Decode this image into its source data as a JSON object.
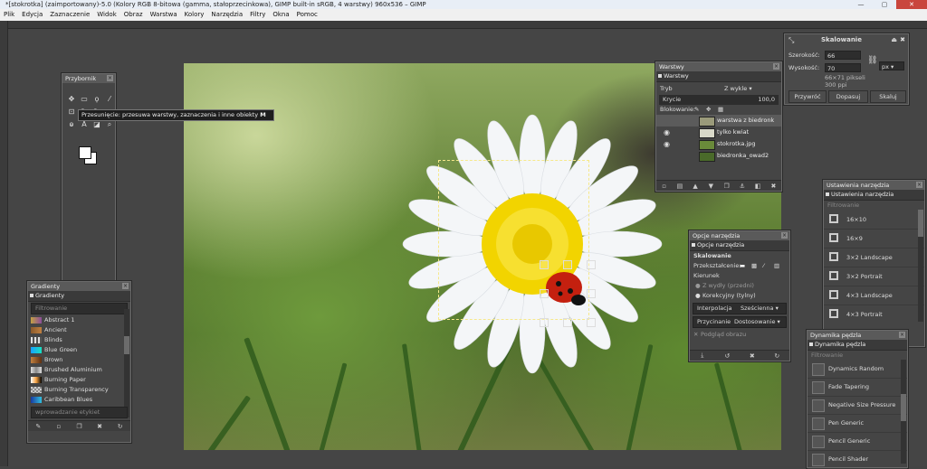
{
  "window": {
    "title": "*[stokrotka] (zaimportowany)-5.0 (Kolory RGB 8-bitowa (gamma, stałoprzecinkowa), GIMP built-in sRGB, 4 warstwy) 960x536 – GIMP",
    "minimize": "—",
    "maximize": "▢",
    "close": "✕"
  },
  "menubar": [
    "Plik",
    "Edycja",
    "Zaznaczenie",
    "Widok",
    "Obraz",
    "Warstwa",
    "Kolory",
    "Narzędzia",
    "Filtry",
    "Okna",
    "Pomoc"
  ],
  "toolbox": {
    "title": "Przybornik",
    "tooltip": "Przesunięcie: przesuwa warstwy, zaznaczenia i inne obiekty",
    "tooltip_key": "M",
    "icons": [
      "move-tool-icon",
      "rect-select-icon",
      "free-select-icon",
      "fuzzy-select-icon",
      "crop-icon",
      "rotate-icon",
      "scale-icon",
      "flip-icon",
      "paths-icon",
      "text-icon",
      "fill-icon",
      "zoom-icon"
    ],
    "glyphs": [
      "✥",
      "▭",
      "ϙ",
      "⁄",
      "⊡",
      "↻",
      "⤡",
      "⇋",
      "ⱺ",
      "A",
      "◪",
      "⌕"
    ]
  },
  "gradients": {
    "title": "Gradienty",
    "tab": "Gradienty",
    "filter_placeholder": "Filtrowanie",
    "items": [
      {
        "name": "Abstract 1",
        "colors": [
          "#c2a043",
          "#8b4c99"
        ]
      },
      {
        "name": "Ancient",
        "colors": [
          "#8a5a2b",
          "#c08040"
        ]
      },
      {
        "name": "Blinds",
        "colors": [
          "#e0e0e0",
          "#555555"
        ]
      },
      {
        "name": "Blue Green",
        "colors": [
          "#18a0ff",
          "#18e0c0"
        ]
      },
      {
        "name": "Brown",
        "colors": [
          "#c08040",
          "#603010"
        ]
      },
      {
        "name": "Brushed Aluminium",
        "colors": [
          "#dddddd",
          "#888888"
        ]
      },
      {
        "name": "Burning Paper",
        "colors": [
          "#ffffff",
          "#000000"
        ]
      },
      {
        "name": "Burning Transparency",
        "colors": [
          "#888888",
          "#cccccc"
        ]
      },
      {
        "name": "Caribbean Blues",
        "colors": [
          "#1a3aa0",
          "#30c0e0"
        ]
      }
    ],
    "tags_placeholder": "wprowadzanie etykiet"
  },
  "layers": {
    "title": "Warstwy",
    "tab": "Warstwy",
    "mode_label": "Tryb",
    "mode_value": "Z wykle",
    "opacity_label": "Krycie",
    "opacity_value": "100,0",
    "lock_label": "Blokowanie:",
    "items": [
      {
        "name": "warstwa z biedronk",
        "visible": false,
        "selected": true,
        "thumb": "#9a9a7a"
      },
      {
        "name": "tylko kwiat",
        "visible": true,
        "selected": false,
        "thumb": "#d8d8c8"
      },
      {
        "name": "stokrotka.jpg",
        "visible": true,
        "selected": false,
        "thumb": "#6a8a3a"
      },
      {
        "name": "biedronka_owad2",
        "visible": false,
        "selected": false,
        "thumb": "#4a6a2a"
      }
    ]
  },
  "scale_dialog": {
    "title": "Skalowanie",
    "width_label": "Szerokość:",
    "width_value": "66",
    "height_label": "Wysokość:",
    "height_value": "70",
    "size_info": "66×71 pikseli",
    "dpi_info": "300 ppi",
    "unit": "px",
    "buttons": [
      "Przywróć",
      "Dopasuj",
      "Skaluj"
    ]
  },
  "tool_options": {
    "title": "Opcje narzędzia",
    "tab": "Opcje narzędzia",
    "heading": "Skalowanie",
    "transform_label": "Przekształcenie:",
    "direction_label": "Kierunek",
    "direction_options": [
      "Z wydły (przedni)",
      "Korekcyjny (tylny)"
    ],
    "interp_label": "Interpolacja",
    "interp_value": "Sześcienna",
    "clip_label": "Przycinanie",
    "clip_value": "Dostosowanie",
    "preview_label": "Podgląd obrazu"
  },
  "tool_presets": {
    "title": "Ustawienia narzędzia",
    "tab": "Ustawienia narzędzia",
    "filter_placeholder": "Filtrowanie",
    "items": [
      "16×10",
      "16×9",
      "3×2 Landscape",
      "3×2 Portrait",
      "4×3 Landscape",
      "4×3 Portrait"
    ]
  },
  "paint_dynamics": {
    "title": "Dynamika pędzla",
    "tab": "Dynamika pędzla",
    "filter_placeholder": "Filtrowanie",
    "items": [
      "Dynamics Random",
      "Fade Tapering",
      "Negative Size Pressure",
      "Pen Generic",
      "Pencil Generic",
      "Pencil Shader"
    ]
  }
}
